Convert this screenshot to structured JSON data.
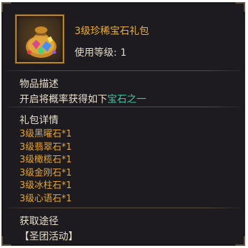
{
  "item": {
    "name": "3级珍稀宝石礼包",
    "level_label": "使用等级:",
    "level_value": "1",
    "icon": "gem-gift-bag-icon"
  },
  "description": {
    "heading": "物品描述",
    "text_prefix": "开启将概率获得如下",
    "text_highlight": "宝石之一"
  },
  "contents": {
    "heading": "礼包详情",
    "items": [
      "3级黑曜石*1",
      "3级翡翠石*1",
      "3级橄榄石*1",
      "3级金刚石*1",
      "3级冰柱石*1",
      "3级心语石*1"
    ]
  },
  "acquire": {
    "heading": "获取途径",
    "source": "【圣团活动】"
  },
  "colors": {
    "title": "#f0b030",
    "highlight": "#3ec7a6",
    "item_text": "#e8a632",
    "panel_bg": "#1d1b1f"
  }
}
